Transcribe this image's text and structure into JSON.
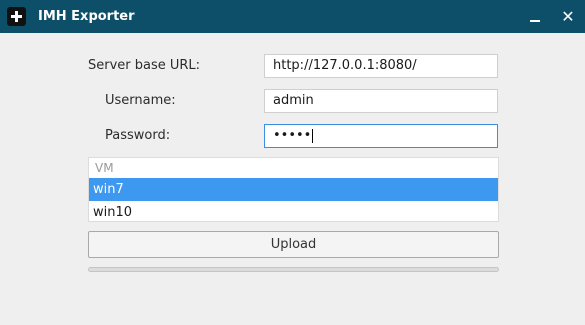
{
  "window": {
    "title": "IMH Exporter",
    "minimize_icon": "minimize-icon",
    "close_icon": "close-icon",
    "close_glyph": "✕"
  },
  "form": {
    "server_url": {
      "label": "Server base URL:",
      "value": "http://127.0.0.1:8080/"
    },
    "username": {
      "label": "Username:",
      "value": "admin"
    },
    "password": {
      "label": "Password:",
      "value": "•••••"
    }
  },
  "vm_list": {
    "header": "VM",
    "items": [
      "win7",
      "win10"
    ],
    "selected": "win7"
  },
  "upload": {
    "label": "Upload",
    "progress": 0
  },
  "colors": {
    "titlebar": "#0d4f68",
    "selection": "#3d98ef",
    "focus_border": "#3d8ee0",
    "background": "#efefef"
  }
}
